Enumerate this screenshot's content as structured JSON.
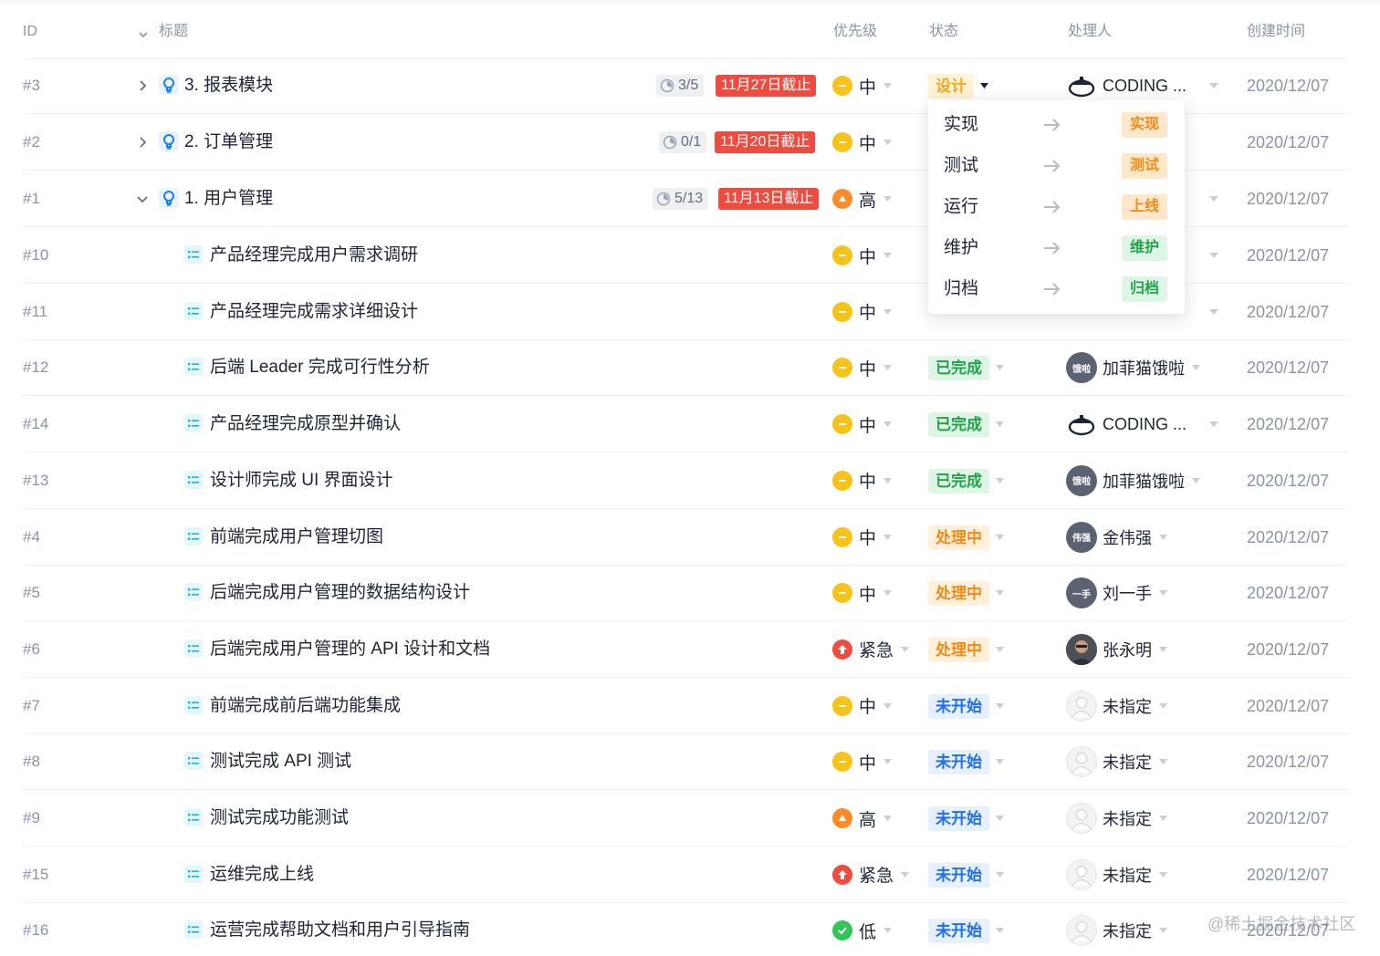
{
  "header": {
    "id": "ID",
    "title": "标题",
    "priority": "优先级",
    "status": "状态",
    "owner": "处理人",
    "created": "创建时间"
  },
  "colors": {
    "status_design_bg": "#fff3d6",
    "status_design_fg": "#f5a623",
    "status_done_bg": "#dff6e6",
    "status_done_fg": "#22a34a",
    "status_doing_bg": "#fff0db",
    "status_doing_fg": "#f08c16",
    "status_todo_bg": "#e6f0ff",
    "status_todo_fg": "#1f6feb",
    "priority_mid": "#f7c31b",
    "priority_high": "#ff8a2a",
    "priority_urgent": "#f04b3f",
    "priority_low": "#35c45a",
    "deadline": "#f04b3f"
  },
  "epics": [
    {
      "id": "#3",
      "title": "3. 报表模块",
      "progress": "3/5",
      "deadline": "11月27日截止",
      "priority": "中",
      "status": "设计",
      "owner": "CODING ...",
      "created": "2020/12/07"
    },
    {
      "id": "#2",
      "title": "2. 订单管理",
      "progress": "0/1",
      "deadline": "11月20日截止",
      "priority": "中",
      "status": "",
      "owner": "",
      "created": "2020/12/07"
    },
    {
      "id": "#1",
      "title": "1. 用户管理",
      "progress": "5/13",
      "deadline": "11月13日截止",
      "priority": "高",
      "status": "",
      "owner": "",
      "created": "2020/12/07"
    }
  ],
  "tasks": [
    {
      "id": "#10",
      "title": "产品经理完成用户需求调研",
      "priority": "中",
      "status": "",
      "owner": "",
      "created": "2020/12/07"
    },
    {
      "id": "#11",
      "title": "产品经理完成需求详细设计",
      "priority": "中",
      "status": "",
      "owner": "",
      "created": "2020/12/07"
    },
    {
      "id": "#12",
      "title": "后端 Leader 完成可行性分析",
      "priority": "中",
      "status": "已完成",
      "owner": "加菲猫饿啦",
      "avatar": "饿啦",
      "created": "2020/12/07"
    },
    {
      "id": "#14",
      "title": "产品经理完成原型并确认",
      "priority": "中",
      "status": "已完成",
      "owner": "CODING ...",
      "created": "2020/12/07"
    },
    {
      "id": "#13",
      "title": "设计师完成 UI 界面设计",
      "priority": "中",
      "status": "已完成",
      "owner": "加菲猫饿啦",
      "avatar": "饿啦",
      "created": "2020/12/07"
    },
    {
      "id": "#4",
      "title": "前端完成用户管理切图",
      "priority": "中",
      "status": "处理中",
      "owner": "金伟强",
      "avatar": "伟强",
      "created": "2020/12/07"
    },
    {
      "id": "#5",
      "title": "后端完成用户管理的数据结构设计",
      "priority": "中",
      "status": "处理中",
      "owner": "刘一手",
      "avatar": "一手",
      "created": "2020/12/07"
    },
    {
      "id": "#6",
      "title": "后端完成用户管理的 API 设计和文档",
      "priority": "紧急",
      "status": "处理中",
      "owner": "张永明",
      "created": "2020/12/07"
    },
    {
      "id": "#7",
      "title": "前端完成前后端功能集成",
      "priority": "中",
      "status": "未开始",
      "owner": "未指定",
      "created": "2020/12/07"
    },
    {
      "id": "#8",
      "title": "测试完成 API 测试",
      "priority": "中",
      "status": "未开始",
      "owner": "未指定",
      "created": "2020/12/07"
    },
    {
      "id": "#9",
      "title": "测试完成功能测试",
      "priority": "高",
      "status": "未开始",
      "owner": "未指定",
      "created": "2020/12/07"
    },
    {
      "id": "#15",
      "title": "运维完成上线",
      "priority": "紧急",
      "status": "未开始",
      "owner": "未指定",
      "created": "2020/12/07"
    },
    {
      "id": "#16",
      "title": "运营完成帮助文档和用户引导指南",
      "priority": "低",
      "status": "未开始",
      "owner": "未指定",
      "created": "2020/12/07"
    }
  ],
  "dropdown": {
    "items": [
      {
        "label": "实现",
        "tag": "实现"
      },
      {
        "label": "测试",
        "tag": "测试"
      },
      {
        "label": "运行",
        "tag": "上线"
      },
      {
        "label": "维护",
        "tag": "维护"
      },
      {
        "label": "归档",
        "tag": "归档"
      }
    ]
  },
  "watermark": "@稀土掘金技术社区"
}
